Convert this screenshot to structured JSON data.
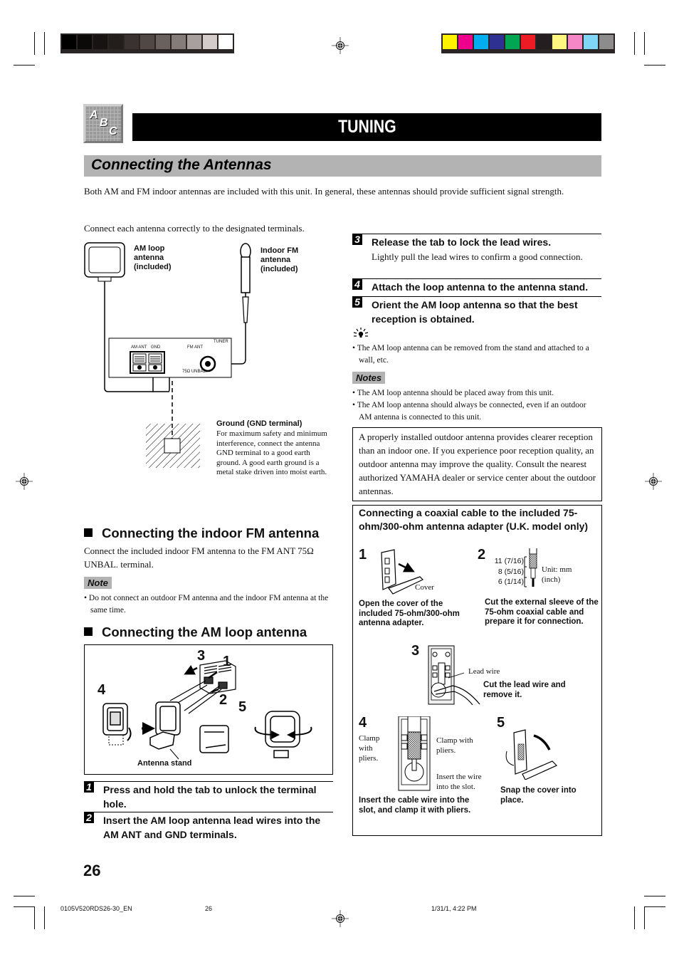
{
  "print_marks": {
    "grayscale_swatches": [
      "#000000",
      "#0c0a09",
      "#161312",
      "#221e1c",
      "#3a3230",
      "#514845",
      "#6a605d",
      "#857b79",
      "#a8a09f",
      "#d4cccb",
      "#ffffff"
    ],
    "color_swatches": [
      "#fff100",
      "#ec008c",
      "#00aeef",
      "#2e3192",
      "#00a651",
      "#ed1c24",
      "#231f20",
      "#fff77f",
      "#f587c6",
      "#7fd6f7",
      "#8c8c8c"
    ]
  },
  "header": {
    "icon_letters": [
      "A",
      "B",
      "C"
    ],
    "chapter_title": "TUNING",
    "section_title": "Connecting the Antennas"
  },
  "intro": {
    "paragraph1": "Both AM and FM indoor antennas are included with this unit. In general, these antennas should provide sufficient signal strength.",
    "paragraph2": "Connect each antenna correctly to the designated terminals."
  },
  "diagram_main": {
    "am_label": "AM loop\nantenna\n(included)",
    "fm_label": "Indoor FM\nantenna\n(included)",
    "tuner_label": "TUNER",
    "am_ant_label": "AM ANT",
    "gnd_label": "GND",
    "fm_ant_label": "FM ANT",
    "unbal_label": "75Ω UNBAL.",
    "ground_title": "Ground (GND terminal)",
    "ground_text": "For maximum safety and minimum interference, connect the antenna GND terminal to a good earth ground. A good earth ground is a metal stake driven into moist earth."
  },
  "fm_section": {
    "heading": "Connecting the indoor FM antenna",
    "text": "Connect the included indoor FM antenna to the FM ANT 75Ω UNBAL. terminal.",
    "note_label": "Note",
    "note_items": [
      "Do not connect an outdoor FM antenna and the indoor FM antenna at the same time."
    ]
  },
  "am_section": {
    "heading": "Connecting the AM loop antenna",
    "diagram_labels": {
      "n1": "1",
      "n2": "2",
      "n3": "3",
      "n4": "4",
      "n5": "5",
      "stand": "Antenna stand"
    },
    "steps": [
      {
        "num": "1",
        "title": "Press and hold the tab to unlock the terminal hole."
      },
      {
        "num": "2",
        "title": "Insert the AM loop antenna lead wires into the AM ANT and GND terminals."
      },
      {
        "num": "3",
        "title": "Release the tab to lock the lead wires.",
        "text": "Lightly pull the lead wires to confirm a good connection."
      },
      {
        "num": "4",
        "title": "Attach the loop antenna to the antenna stand."
      },
      {
        "num": "5",
        "title": "Orient the AM loop antenna so that the best reception is obtained."
      }
    ],
    "tip_icon": "lightbulb-icon",
    "tip_items": [
      "The AM loop antenna can be removed from the stand and attached to a wall, etc."
    ],
    "notes_label": "Notes",
    "notes_items": [
      "The AM loop antenna should be placed away from this unit.",
      "The AM loop antenna should always be connected, even if an outdoor AM antenna is connected to this unit."
    ]
  },
  "outdoor_box": {
    "text": "A properly installed outdoor antenna provides clearer reception than an indoor one. If you experience poor reception quality, an outdoor antenna may improve the quality. Consult the nearest authorized YAMAHA dealer or service center about the outdoor antennas."
  },
  "coax_box": {
    "title": "Connecting a coaxial cable to the included 75-ohm/300-ohm antenna adapter (U.K. model only)",
    "steps": [
      {
        "num": "1",
        "caption": "Open the cover of the included 75-ohm/300-ohm antenna adapter.",
        "callouts": [
          "Cover"
        ]
      },
      {
        "num": "2",
        "caption": "Cut the external sleeve of the 75-ohm coaxial cable and prepare it for connection.",
        "dims": [
          "11 (7/16)",
          "8 (5/16)",
          "6 (1/14)"
        ],
        "unit": "Unit: mm\n(inch)"
      },
      {
        "num": "3",
        "caption": "Cut the lead wire and remove it.",
        "callouts": [
          "Lead wire"
        ]
      },
      {
        "num": "4",
        "caption": "Insert the cable wire into the slot, and clamp it with pliers.",
        "callouts": [
          "Clamp\nwith\npliers.",
          "Clamp with\npliers.",
          "Insert the wire\ninto the slot."
        ]
      },
      {
        "num": "5",
        "caption": "Snap the cover into place."
      }
    ]
  },
  "footer": {
    "page_number": "26",
    "file_id": "0105V520RDS26-30_EN",
    "sheet_number": "26",
    "timestamp": "1/31/1, 4:22 PM"
  }
}
